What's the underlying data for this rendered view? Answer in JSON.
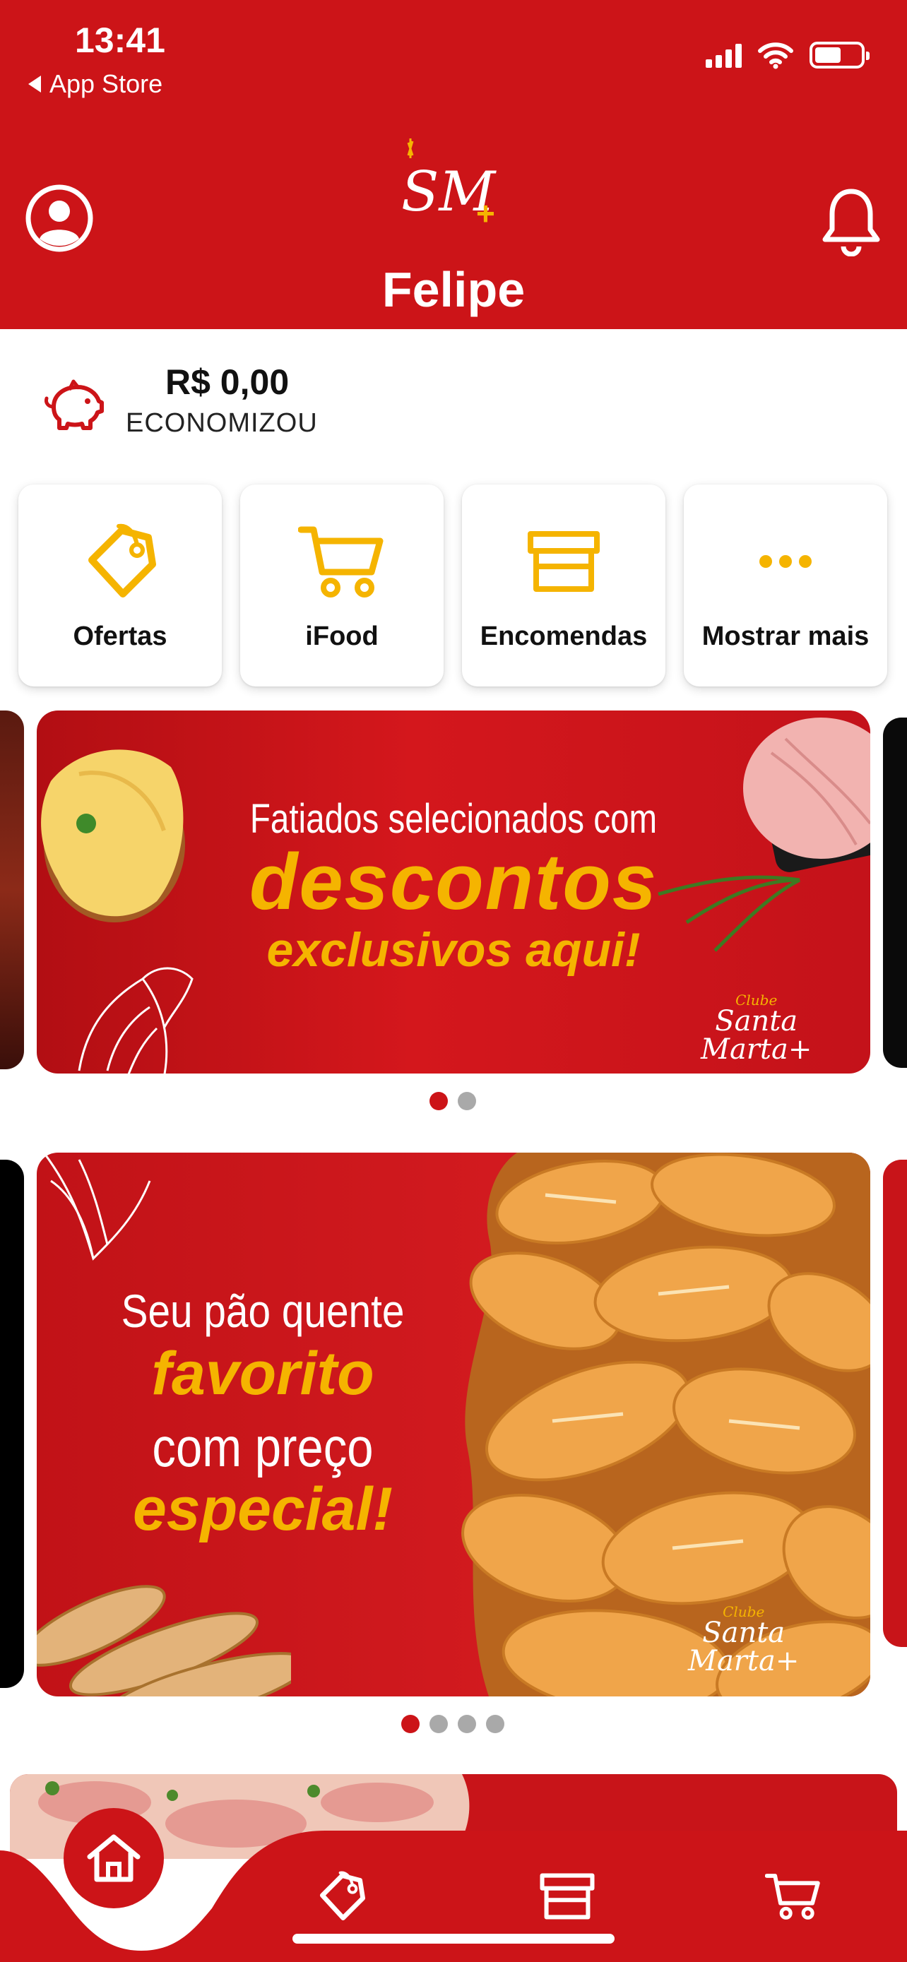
{
  "status_bar": {
    "time": "13:41",
    "back_label": "App Store",
    "icons": [
      "signal-icon",
      "wifi-icon",
      "battery-icon"
    ]
  },
  "header": {
    "logo_text": "SM+",
    "user_name": "Felipe",
    "left_icon": "user-circle-icon",
    "right_icon": "bell-icon",
    "background": "#cc1418"
  },
  "savings": {
    "value": "R$ 0,00",
    "label": "ECONOMIZOU",
    "icon": "piggy-bank-icon"
  },
  "quick_actions": [
    {
      "label": "Ofertas",
      "icon": "tag-icon"
    },
    {
      "label": "iFood",
      "icon": "cart-icon"
    },
    {
      "label": "Encomendas",
      "icon": "store-icon"
    },
    {
      "label": "Mostrar mais",
      "icon": "more-dots-icon"
    }
  ],
  "banners": [
    {
      "lines": [
        "Fatiados selecionados com",
        "descontos",
        "exclusivos aqui!"
      ],
      "brand": [
        "Clube",
        "Santa",
        "Marta+"
      ],
      "dots_total": 2,
      "active_dot": 0
    },
    {
      "lines": [
        "Seu pão quente",
        "favorito",
        "com preço",
        "especial!"
      ],
      "brand": [
        "Clube",
        "Santa",
        "Marta+"
      ],
      "dots_total": 4,
      "active_dot": 0
    }
  ],
  "tab_bar": {
    "items": [
      "home-icon",
      "tag-icon",
      "store-icon",
      "cart-icon"
    ],
    "active": "home-icon"
  },
  "colors": {
    "brand_red": "#cc1418",
    "accent_yellow": "#f5b400",
    "dot_inactive": "#a9a9a9"
  }
}
